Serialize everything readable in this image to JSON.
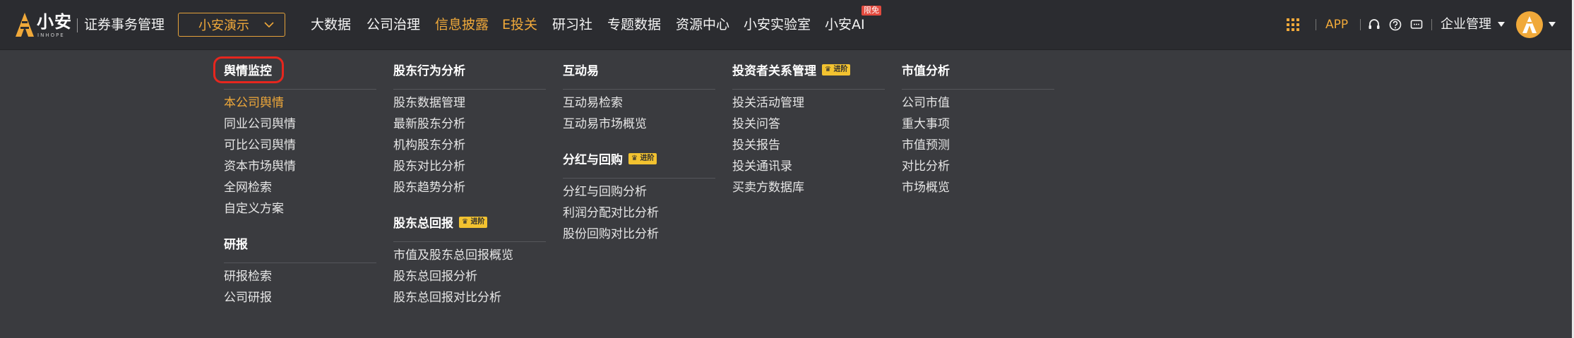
{
  "brand": {
    "logo_text": "小安",
    "logo_sub": "INHOPE",
    "app_title": "证券事务管理",
    "accent": "#f0a93a"
  },
  "company_select": {
    "value": "小安演示",
    "icon": "chevron-down-icon"
  },
  "nav": {
    "items": [
      {
        "label": "大数据",
        "highlight": false
      },
      {
        "label": "公司治理",
        "highlight": false
      },
      {
        "label": "信息披露",
        "highlight": true
      },
      {
        "label": "E投关",
        "highlight": true
      },
      {
        "label": "研习社",
        "highlight": false
      },
      {
        "label": "专题数据",
        "highlight": false
      },
      {
        "label": "资源中心",
        "highlight": false
      },
      {
        "label": "小安实验室",
        "highlight": false
      },
      {
        "label": "小安AI",
        "highlight": false
      }
    ],
    "new_badge": "限免"
  },
  "tools": {
    "grid_icon": "apps-grid-icon",
    "app_label": "APP",
    "support_icon": "headset-icon",
    "help_icon": "help-circle-icon",
    "message_icon": "message-icon",
    "enterprise_menu": "企业管理",
    "avatar_icon": "user-avatar-icon"
  },
  "menu": {
    "pro_tag": "进阶",
    "col1": {
      "group1": {
        "title": "舆情监控",
        "links": [
          "本公司舆情",
          "同业公司舆情",
          "可比公司舆情",
          "资本市场舆情",
          "全网检索",
          "自定义方案"
        ]
      },
      "group2": {
        "title": "研报",
        "links": [
          "研报检索",
          "公司研报"
        ]
      }
    },
    "col2": {
      "group1": {
        "title": "股东行为分析",
        "links": [
          "股东数据管理",
          "最新股东分析",
          "机构股东分析",
          "股东对比分析",
          "股东趋势分析"
        ]
      },
      "group2": {
        "title": "股东总回报",
        "links": [
          "市值及股东总回报概览",
          "股东总回报分析",
          "股东总回报对比分析"
        ]
      }
    },
    "col3": {
      "group1": {
        "title": "互动易",
        "links": [
          "互动易检索",
          "互动易市场概览"
        ]
      },
      "group2": {
        "title": "分红与回购",
        "links": [
          "分红与回购分析",
          "利润分配对比分析",
          "股份回购对比分析"
        ]
      }
    },
    "col4": {
      "group1": {
        "title": "投资者关系管理",
        "links": [
          "投关活动管理",
          "投关问答",
          "投关报告",
          "投关通讯录",
          "买卖方数据库"
        ]
      }
    },
    "col5": {
      "group1": {
        "title": "市值分析",
        "links": [
          "公司市值",
          "重大事项",
          "市值预测",
          "对比分析",
          "市场概览"
        ]
      }
    }
  }
}
